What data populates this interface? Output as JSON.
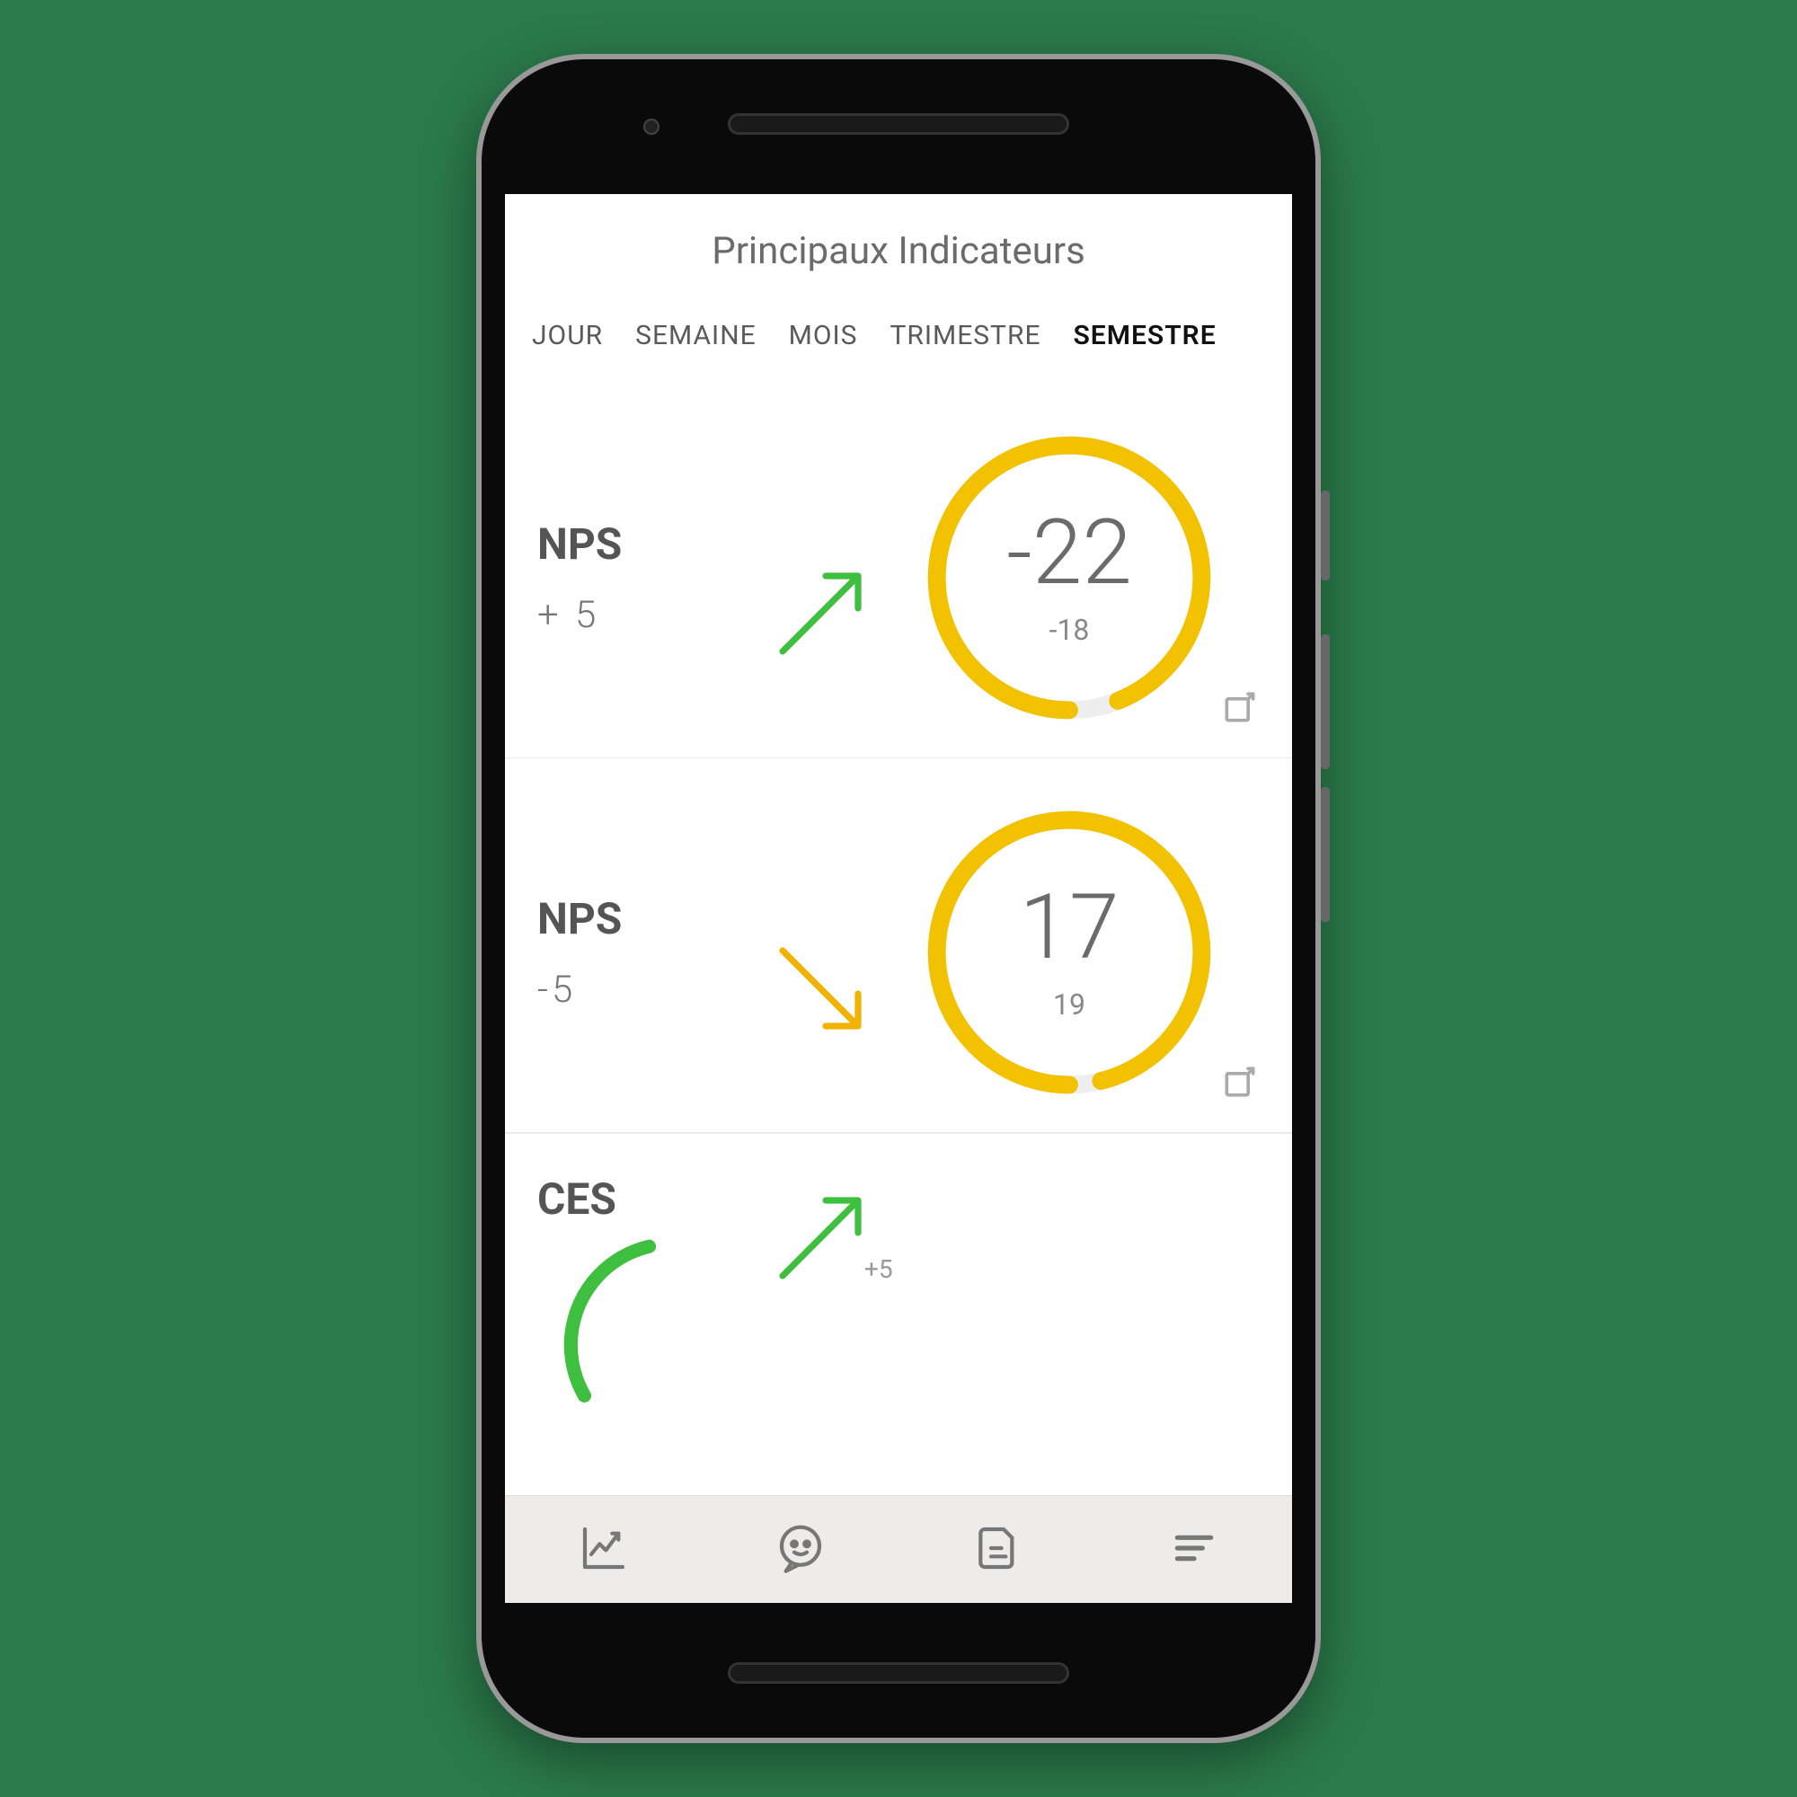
{
  "header": {
    "title": "Principaux Indicateurs"
  },
  "tabs": {
    "items": [
      "JOUR",
      "SEMAINE",
      "MOIS",
      "TRIMESTRE",
      "SEMESTRE"
    ],
    "active_index": 4
  },
  "cards": [
    {
      "label": "NPS",
      "delta_text": "+ 5",
      "trend": "up",
      "trend_color": "#3fbf3f",
      "ring_color": "#f2c200",
      "ring_percent": 94,
      "main_value": "-22",
      "sub_value": "-18"
    },
    {
      "label": "NPS",
      "delta_text": "-5",
      "trend": "down",
      "trend_color": "#f2b200",
      "ring_color": "#f2c200",
      "ring_percent": 96,
      "main_value": "17",
      "sub_value": "19"
    }
  ],
  "partial_card": {
    "label": "CES",
    "trend": "up",
    "trend_color": "#3fbf3f",
    "ring_color": "#3fbf3f",
    "sub_text": "+5"
  },
  "nav": {
    "items": [
      "chart-icon",
      "chat-icon",
      "document-icon",
      "menu-icon"
    ]
  },
  "colors": {
    "accent_green": "#3fbf3f",
    "accent_yellow": "#f2c200",
    "text_muted": "#777"
  }
}
